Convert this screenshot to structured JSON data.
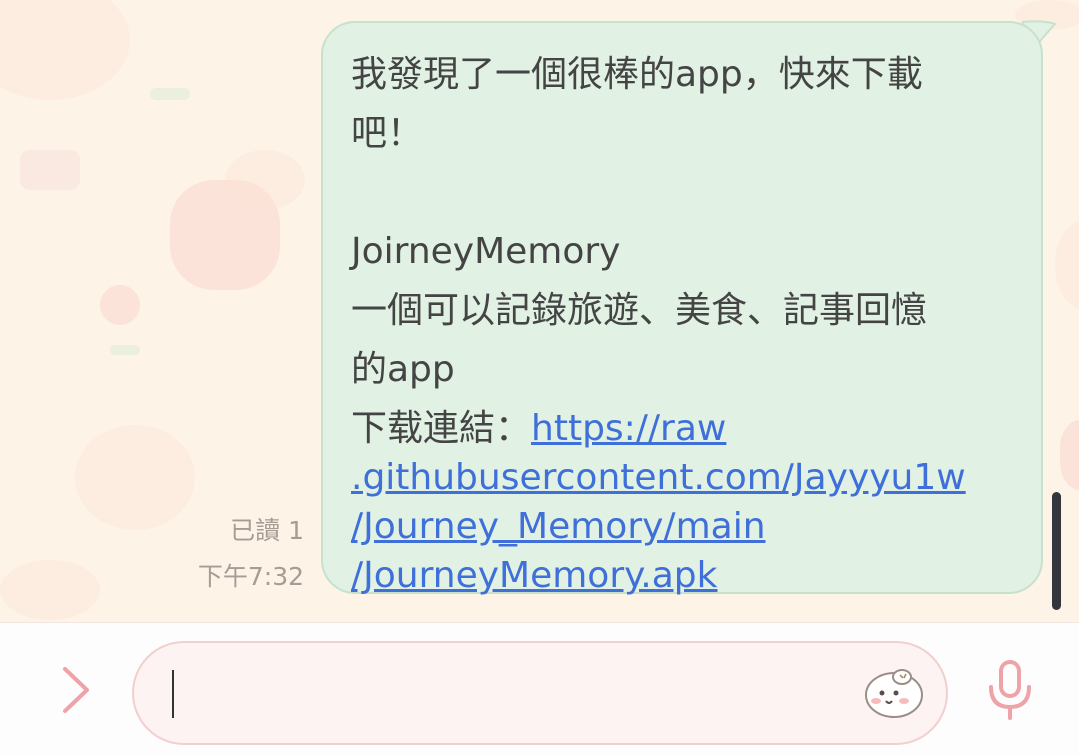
{
  "message": {
    "lines": [
      "我發現了一個很棒的app，快來下載",
      "吧！",
      "",
      "JoirneyMemory",
      "一個可以記錄旅遊、美食、記事回憶",
      "的app"
    ],
    "link_label": "下载連結：",
    "link_lines": [
      "https://raw",
      ".githubusercontent.com/Jayyyu1w",
      "/Journey_Memory/main",
      "/JourneyMemory.apk"
    ]
  },
  "meta": {
    "read_receipt": "已讀 1",
    "time": "下午7:32"
  },
  "input": {
    "placeholder": ""
  },
  "icons": {
    "expand": "chevron-right-icon",
    "sticker": "sticker-icon",
    "mic": "microphone-icon"
  },
  "colors": {
    "bubble_bg": "#e1f1e4",
    "link": "#3f6fd8",
    "accent_pink": "#eea3a8",
    "wallpaper": "#fdf3e6"
  }
}
